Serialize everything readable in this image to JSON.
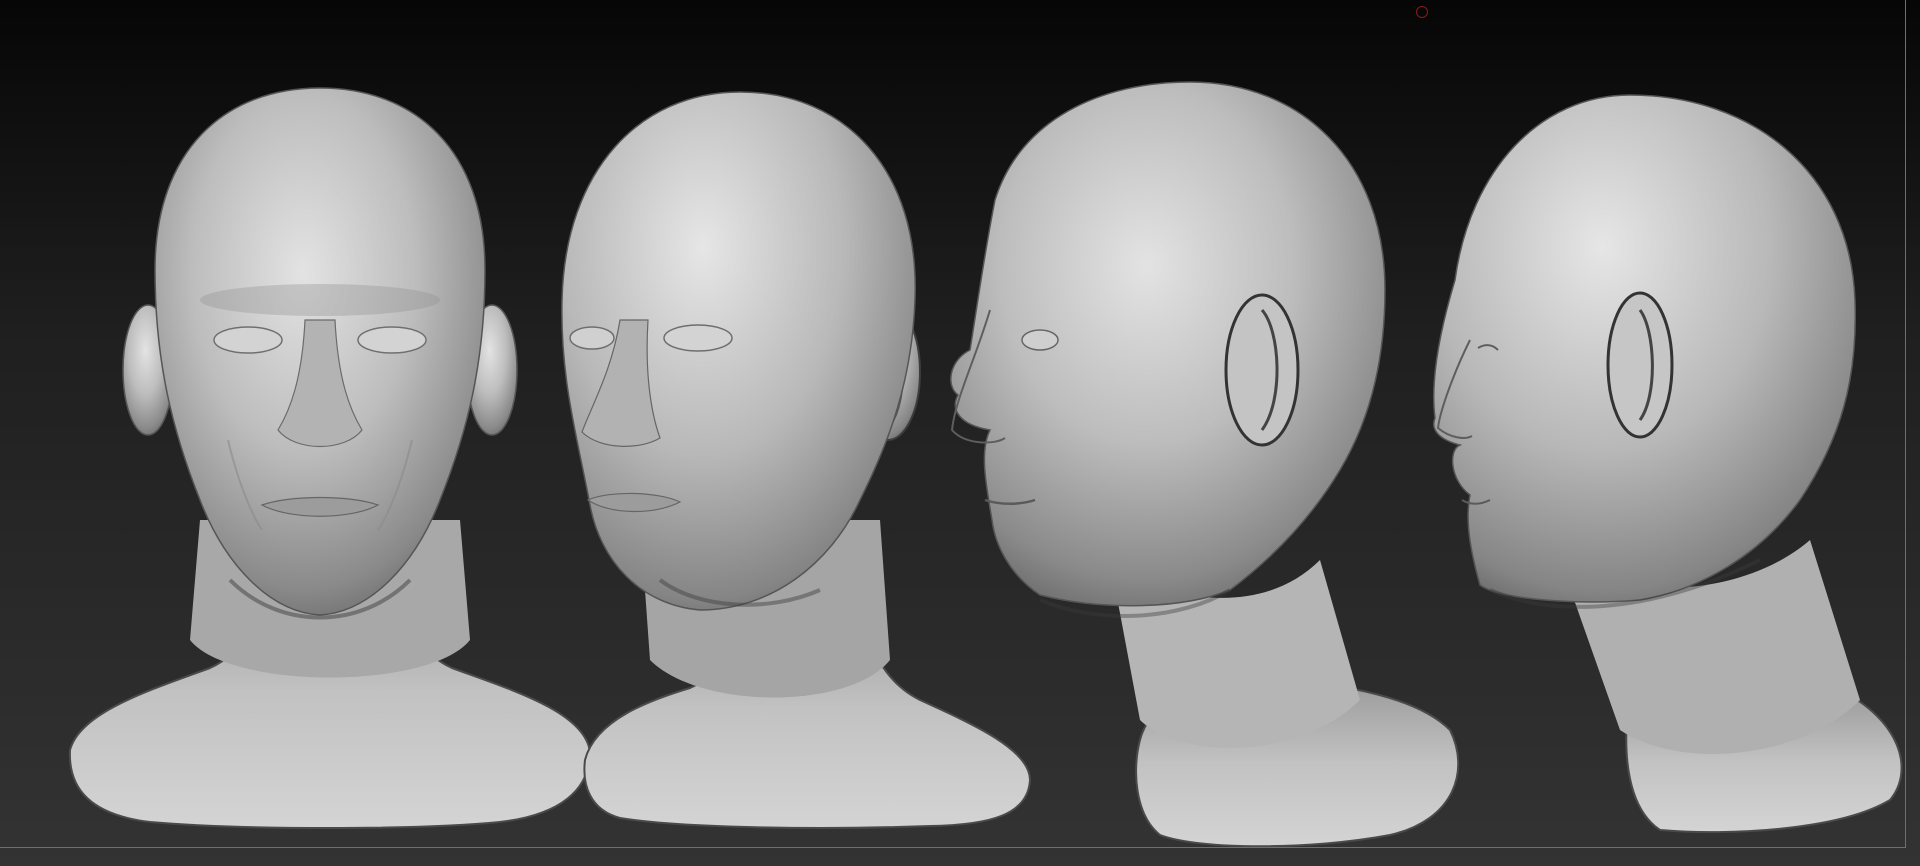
{
  "viewport": {
    "title": "",
    "background_top": "#060606",
    "background_bottom": "#333333",
    "material_color": "#bdbdbd"
  },
  "models": [
    {
      "name": "head-front-view",
      "view": "front"
    },
    {
      "name": "head-three-quarter-view",
      "view": "three-quarter"
    },
    {
      "name": "head-side-view",
      "view": "side"
    },
    {
      "name": "head-back-three-quarter-view",
      "view": "back-three-quarter"
    }
  ],
  "cursor": {
    "icon": "brush-cursor-icon",
    "color": "#8a1a1a"
  }
}
